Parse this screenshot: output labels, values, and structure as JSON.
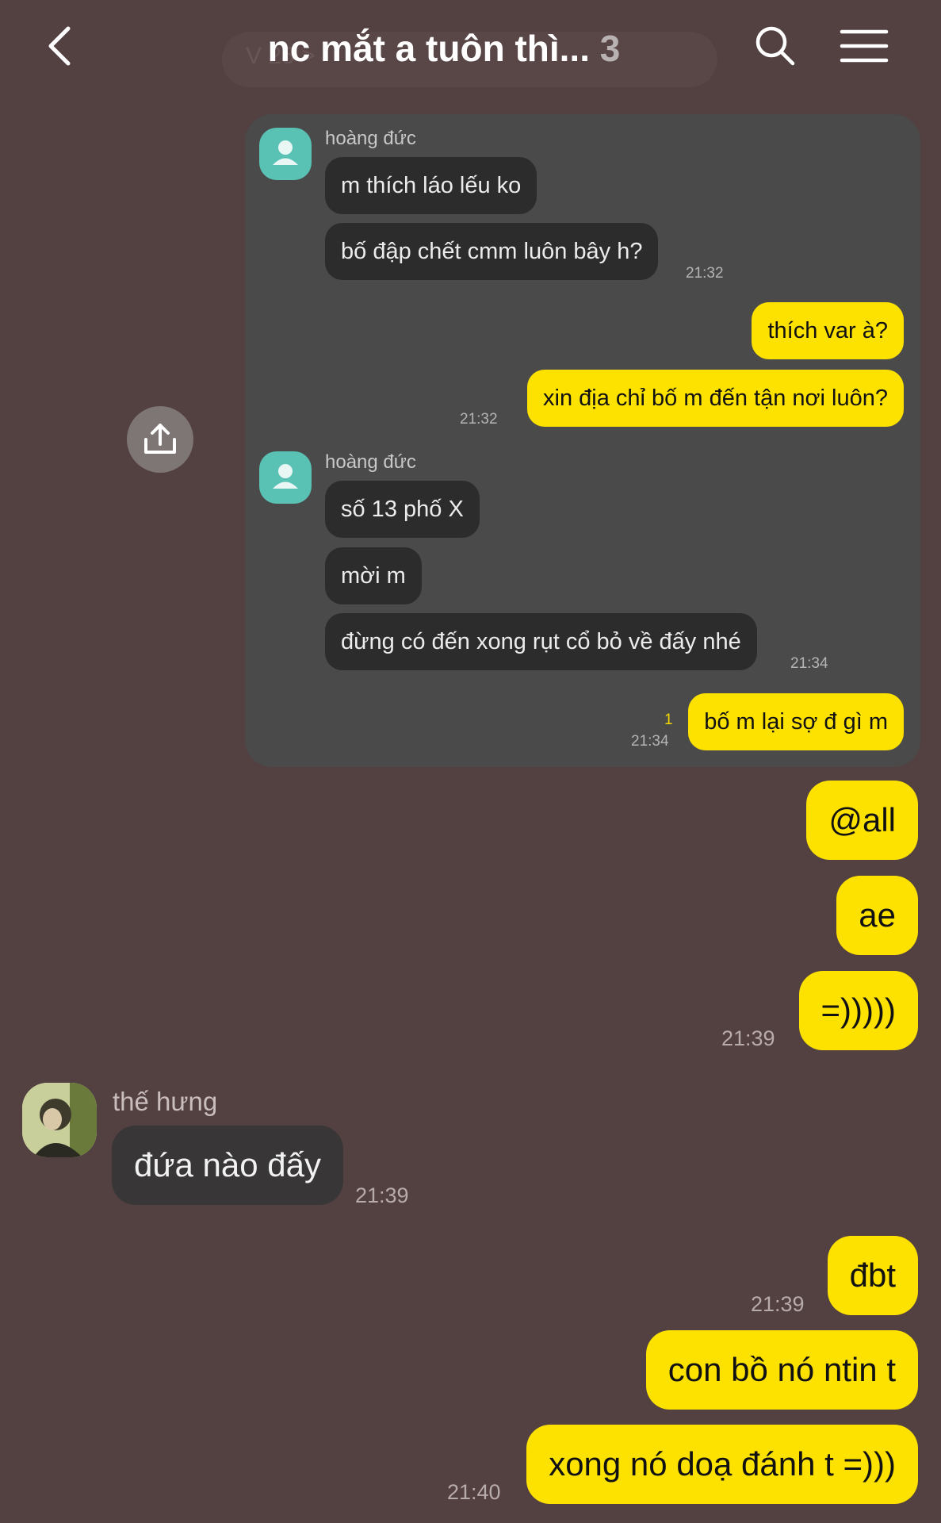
{
  "header": {
    "title": "nc mắt a tuôn thì...",
    "member_count": "3",
    "ghost_banner": "V                  25  >",
    "back_icon": "chevron-left-icon",
    "search_icon": "search-icon",
    "menu_icon": "hamburger-menu-icon"
  },
  "share_icon": "share-icon",
  "shared_screenshot": {
    "group1": {
      "sender": "hoàng đức",
      "messages": [
        "m thích láo lếu ko",
        "bố đập chết cmm luôn bây h?"
      ],
      "time": "21:32"
    },
    "mine1": {
      "messages": [
        "thích var à?",
        "xin địa chỉ bố m đến tận nơi luôn?"
      ],
      "time": "21:32"
    },
    "group2": {
      "sender": "hoàng đức",
      "messages": [
        "số 13 phố X",
        "mời m",
        "đừng có đến xong rụt cổ bỏ về đấy nhé"
      ],
      "time": "21:34"
    },
    "mine2": {
      "message": "bố m lại sợ đ gì m",
      "unread": "1",
      "time": "21:34"
    }
  },
  "chat": {
    "my_block_1": {
      "messages": [
        "@all",
        "ae",
        "=)))))"
      ],
      "time": "21:39"
    },
    "their_block": {
      "sender": "thế hưng",
      "message": "đứa nào đấy",
      "time": "21:39"
    },
    "my_block_2": {
      "messages": [
        "đbt",
        "con bồ nó ntin t",
        "xong nó doạ đánh t =)))"
      ],
      "time_1": "21:39",
      "time_2": "21:40"
    }
  },
  "colors": {
    "background": "#534041",
    "my_bubble": "#fde200",
    "their_bubble": "#383637",
    "card": "#4a4a4a",
    "avatar_teal": "#59c2b5"
  }
}
